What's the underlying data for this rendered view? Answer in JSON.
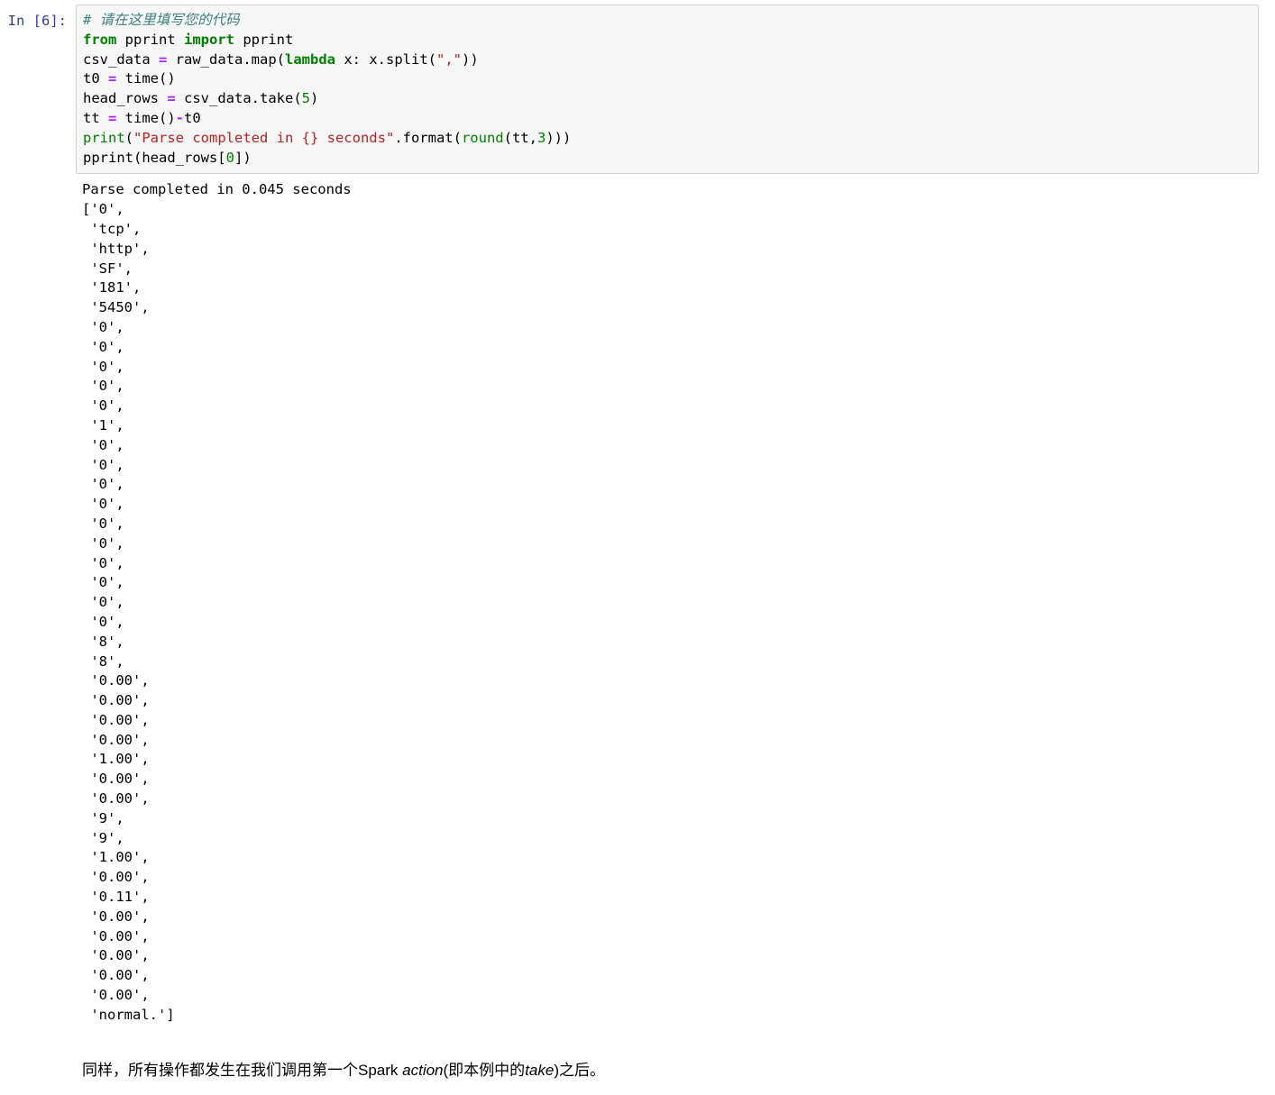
{
  "cell": {
    "prompt": "In [6]:",
    "code_lines": [
      [
        {
          "t": "c",
          "v": "# 请在这里填写您的代码"
        }
      ],
      [
        {
          "t": "k",
          "v": "from"
        },
        {
          "t": "n",
          "v": " pprint "
        },
        {
          "t": "k",
          "v": "import"
        },
        {
          "t": "n",
          "v": " pprint"
        }
      ],
      [
        {
          "t": "n",
          "v": "csv_data "
        },
        {
          "t": "o",
          "v": "="
        },
        {
          "t": "n",
          "v": " raw_data.map("
        },
        {
          "t": "k",
          "v": "lambda"
        },
        {
          "t": "n",
          "v": " x: x.split("
        },
        {
          "t": "s",
          "v": "\",\""
        },
        {
          "t": "n",
          "v": "))"
        }
      ],
      [
        {
          "t": "n",
          "v": "t0 "
        },
        {
          "t": "o",
          "v": "="
        },
        {
          "t": "n",
          "v": " time()"
        }
      ],
      [
        {
          "t": "n",
          "v": "head_rows "
        },
        {
          "t": "o",
          "v": "="
        },
        {
          "t": "n",
          "v": " csv_data.take("
        },
        {
          "t": "mi",
          "v": "5"
        },
        {
          "t": "n",
          "v": ")"
        }
      ],
      [
        {
          "t": "n",
          "v": "tt "
        },
        {
          "t": "o",
          "v": "="
        },
        {
          "t": "n",
          "v": " time()"
        },
        {
          "t": "o",
          "v": "-"
        },
        {
          "t": "n",
          "v": "t0"
        }
      ],
      [
        {
          "t": "nb",
          "v": "print"
        },
        {
          "t": "n",
          "v": "("
        },
        {
          "t": "s",
          "v": "\"Parse completed in {} seconds\""
        },
        {
          "t": "n",
          "v": ".format("
        },
        {
          "t": "nb",
          "v": "round"
        },
        {
          "t": "n",
          "v": "(tt,"
        },
        {
          "t": "mi",
          "v": "3"
        },
        {
          "t": "n",
          "v": ")))"
        }
      ],
      [
        {
          "t": "n",
          "v": "pprint(head_rows["
        },
        {
          "t": "mi",
          "v": "0"
        },
        {
          "t": "n",
          "v": "])"
        }
      ]
    ],
    "code_plain": "# 请在这里填写您的代码\nfrom pprint import pprint\ncsv_data = raw_data.map(lambda x: x.split(\",\"))\nt0 = time()\nhead_rows = csv_data.take(5)\ntt = time()-t0\nprint(\"Parse completed in {} seconds\".format(round(tt,3)))\npprint(head_rows[0])"
  },
  "output": {
    "status_line": "Parse completed in 0.045 seconds",
    "parse_seconds": "0.045",
    "list_values": [
      "0",
      "tcp",
      "http",
      "SF",
      "181",
      "5450",
      "0",
      "0",
      "0",
      "0",
      "0",
      "1",
      "0",
      "0",
      "0",
      "0",
      "0",
      "0",
      "0",
      "0",
      "0",
      "0",
      "8",
      "8",
      "0.00",
      "0.00",
      "0.00",
      "0.00",
      "1.00",
      "0.00",
      "0.00",
      "9",
      "9",
      "1.00",
      "0.00",
      "0.11",
      "0.00",
      "0.00",
      "0.00",
      "0.00",
      "0.00",
      "normal."
    ],
    "text": "Parse completed in 0.045 seconds\n['0',\n 'tcp',\n 'http',\n 'SF',\n '181',\n '5450',\n '0',\n '0',\n '0',\n '0',\n '0',\n '1',\n '0',\n '0',\n '0',\n '0',\n '0',\n '0',\n '0',\n '0',\n '0',\n '0',\n '8',\n '8',\n '0.00',\n '0.00',\n '0.00',\n '0.00',\n '1.00',\n '0.00',\n '0.00',\n '9',\n '9',\n '1.00',\n '0.00',\n '0.11',\n '0.00',\n '0.00',\n '0.00',\n '0.00',\n '0.00',\n 'normal.']"
  },
  "markdown": {
    "para_prefix": "同样，所有操作都发生在我们调用第一个Spark ",
    "em_action": "action",
    "para_mid": "(即本例中的",
    "em_take": "take",
    "para_suffix": ")之后。",
    "para_plain": "同样，所有操作都发生在我们调用第一个Spark action(即本例中的take)之后。"
  },
  "colors": {
    "prompt": "#303f9f",
    "cell_background": "#f7f7f7",
    "cell_border": "#cfcfcf",
    "comment": "#408080",
    "keyword": "#008000",
    "operator": "#aa22ff",
    "string": "#ba2121",
    "number": "#008000",
    "text": "#000000",
    "page_background": "#ffffff"
  }
}
